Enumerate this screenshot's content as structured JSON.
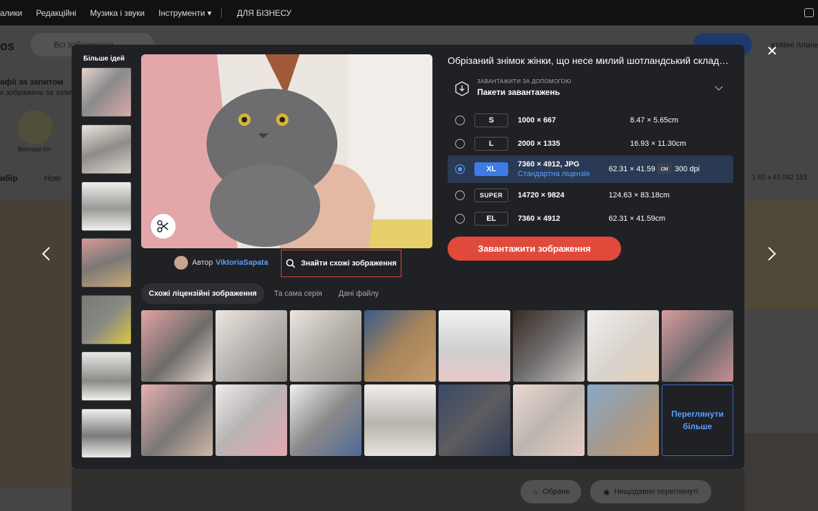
{
  "topnav": {
    "items": [
      "алики",
      "Редакційні",
      "Музика і звуки",
      "Інструменти ▾",
      "ДЛЯ БІЗНЕСУ"
    ]
  },
  "background": {
    "logo": "os",
    "search_placeholder": "Всі зображення",
    "heading": "афії за запитом",
    "subheading": "х зображень за запи",
    "category": "Вектори Кіт",
    "sort_active": "ибір",
    "sort_new": "Нові",
    "pagination": "1-60 з 43 092 153",
    "plan": "ктивні плани",
    "fav_button": "Обране",
    "recent_button": "Нещодавно переглянуті"
  },
  "modal": {
    "ideas_title": "Більше ідей",
    "title": "Обрізаний знімок жінки, що несе милий шотландський складовухий кіт",
    "download_group": {
      "small_label": "ЗАВАНТАЖИТИ ЗА ДОПОМОГОЮ",
      "value": "Пакети завантажень"
    },
    "sizes": [
      {
        "code": "S",
        "px": "1000 × 667",
        "cm": "8.47 × 5.65cm",
        "selected": false
      },
      {
        "code": "L",
        "px": "2000 × 1335",
        "cm": "16.93 × 11.30cm",
        "selected": false
      },
      {
        "code": "XL",
        "px": "7360 × 4912, JPG",
        "license": "Стандартна ліцензія",
        "cm": "62.31 × 41.59",
        "unit": "см",
        "dpi": "300 dpi",
        "selected": true
      },
      {
        "code": "SUPER",
        "px": "14720 × 9824",
        "cm": "124.63 × 83.18cm",
        "selected": false
      },
      {
        "code": "EL",
        "px": "7360 × 4912",
        "cm": "62.31 × 41.59cm",
        "selected": false
      }
    ],
    "download_button": "Завантажити зображення",
    "author_prefix": "Автор",
    "author_name": "ViktoriaSapata",
    "find_similar": "Знайти схожі зображення",
    "tabs": [
      "Схожі ліцензійні зображення",
      "Та сама серія",
      "Дані файлу"
    ],
    "more_tile": "Переглянути більше",
    "colors": {
      "accent": "#e04a3a",
      "link": "#5aa0ff",
      "selected": "#3f7be6"
    }
  }
}
